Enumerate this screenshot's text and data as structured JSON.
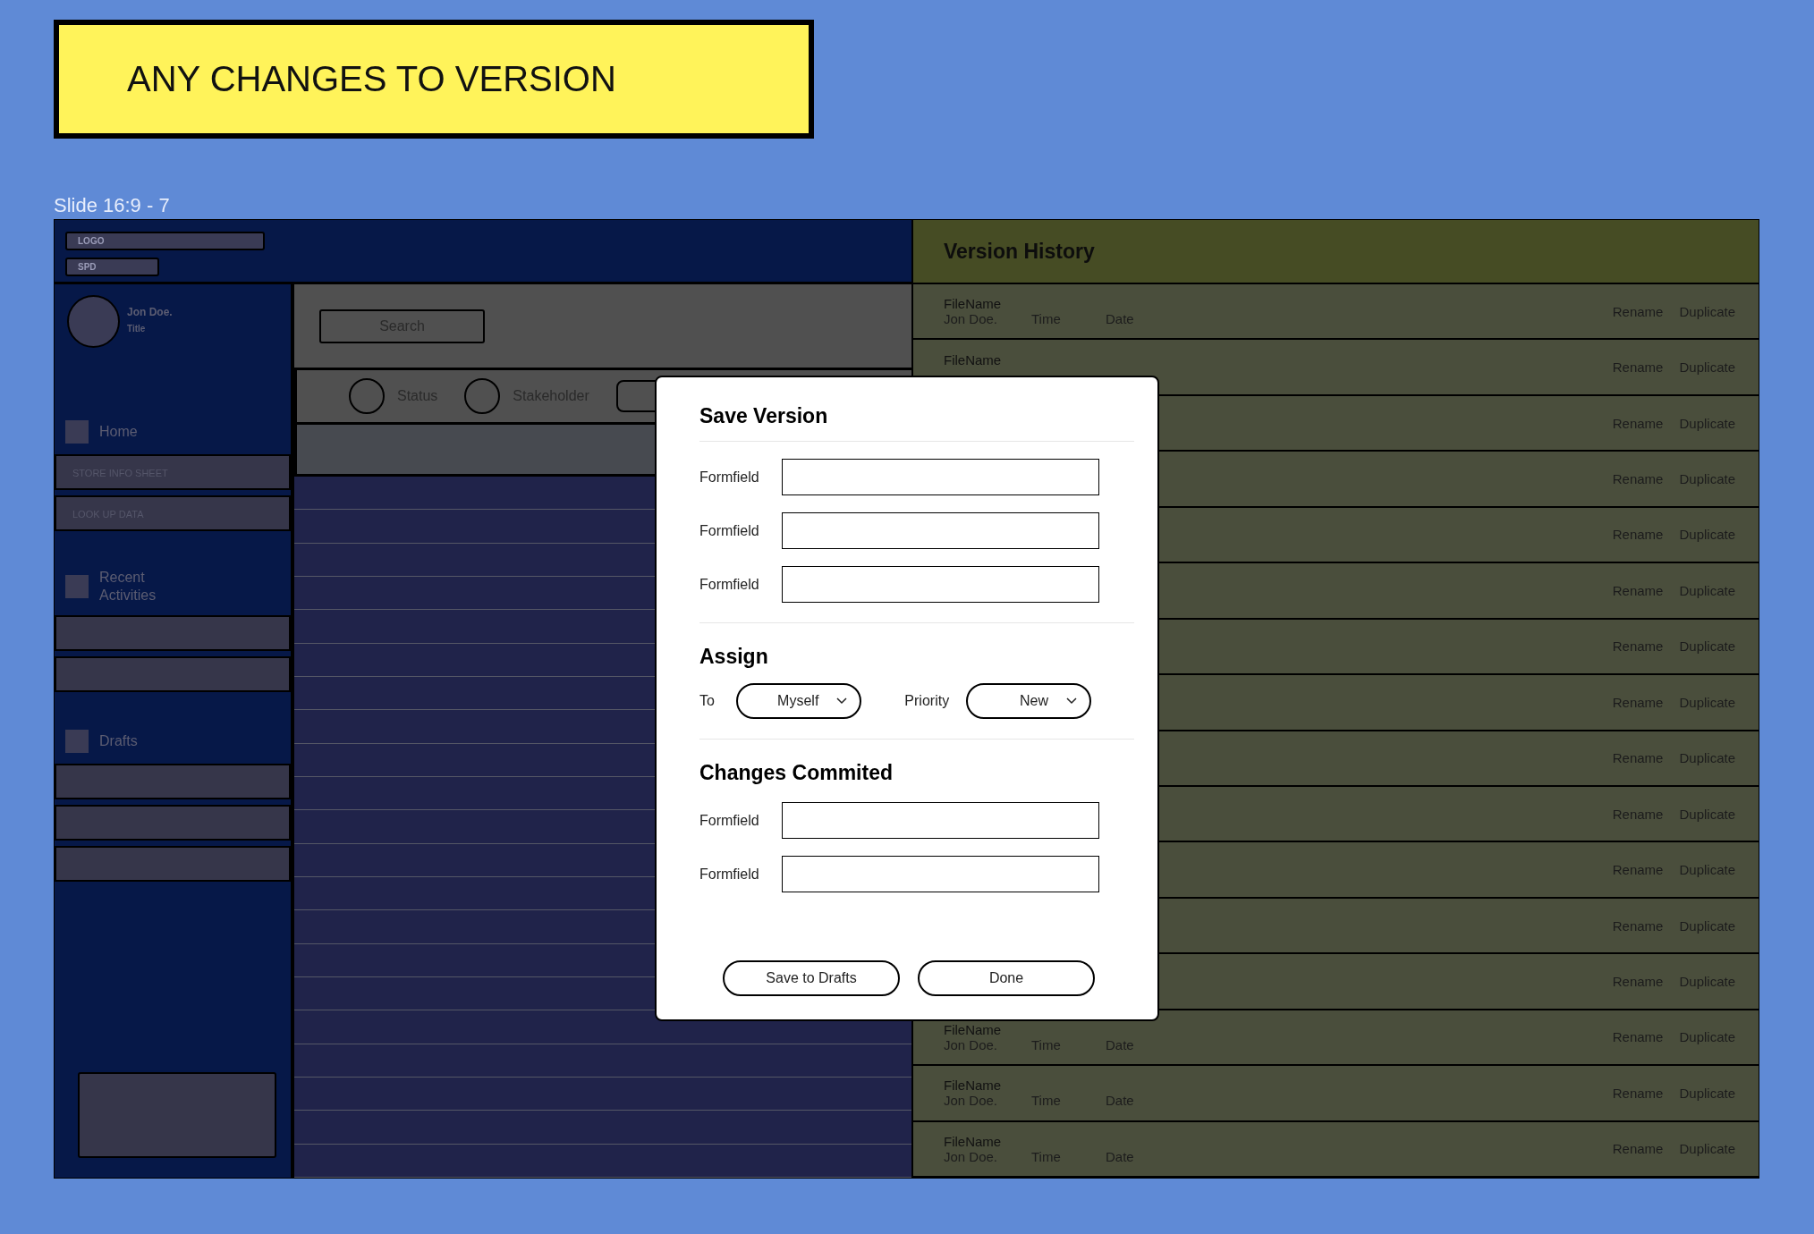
{
  "banner": {
    "text": "ANY CHANGES TO VERSION"
  },
  "frame_label": "Slide 16:9 - 7",
  "app": {
    "header": {
      "logo": "LOGO",
      "subtitle": "SPD"
    },
    "sidebar": {
      "user": {
        "name": "Jon Doe.",
        "title": "Title"
      },
      "sections": [
        {
          "label": "Home",
          "items": [
            {
              "kind": "link",
              "label": "STORE INFO SHEET"
            },
            {
              "kind": "link",
              "label": "LOOK UP DATA"
            }
          ]
        },
        {
          "label": "Recent Activities",
          "items": [
            {
              "kind": "blank"
            },
            {
              "kind": "blank"
            }
          ]
        },
        {
          "label": "Drafts",
          "items": [
            {
              "kind": "blank"
            },
            {
              "kind": "blank"
            },
            {
              "kind": "blank"
            }
          ]
        }
      ]
    },
    "search": {
      "label": "Search"
    },
    "filters": [
      {
        "kind": "radio",
        "label": "Status",
        "checked": false
      },
      {
        "kind": "radio",
        "label": "Stakeholder",
        "checked": false
      },
      {
        "kind": "pill"
      }
    ]
  },
  "version_history": {
    "title": "Version History",
    "rows": [
      {
        "file_name": "FileName",
        "author": "Jon Doe.",
        "time": "Time",
        "date": "Date",
        "actions": [
          "Rename",
          "Duplicate"
        ]
      },
      {
        "file_name": "FileName",
        "actions": [
          "Rename",
          "Duplicate"
        ]
      },
      {
        "actions": [
          "Rename",
          "Duplicate"
        ]
      },
      {
        "actions": [
          "Rename",
          "Duplicate"
        ]
      },
      {
        "actions": [
          "Rename",
          "Duplicate"
        ]
      },
      {
        "actions": [
          "Rename",
          "Duplicate"
        ]
      },
      {
        "actions": [
          "Rename",
          "Duplicate"
        ]
      },
      {
        "actions": [
          "Rename",
          "Duplicate"
        ]
      },
      {
        "actions": [
          "Rename",
          "Duplicate"
        ]
      },
      {
        "actions": [
          "Rename",
          "Duplicate"
        ]
      },
      {
        "actions": [
          "Rename",
          "Duplicate"
        ]
      },
      {
        "actions": [
          "Rename",
          "Duplicate"
        ]
      },
      {
        "actions": [
          "Rename",
          "Duplicate"
        ]
      },
      {
        "file_name": "FileName",
        "author": "Jon Doe.",
        "time": "Time",
        "date": "Date",
        "actions": [
          "Rename",
          "Duplicate"
        ]
      },
      {
        "file_name": "FileName",
        "author": "Jon Doe.",
        "time": "Time",
        "date": "Date",
        "actions": [
          "Rename",
          "Duplicate"
        ]
      },
      {
        "file_name": "FileName",
        "author": "Jon Doe.",
        "time": "Time",
        "date": "Date",
        "actions": [
          "Rename",
          "Duplicate"
        ]
      }
    ]
  },
  "modal": {
    "title": "Save Version",
    "fields": [
      {
        "label": "Formfield"
      },
      {
        "label": "Formfield"
      },
      {
        "label": "Formfield"
      }
    ],
    "assign": {
      "title": "Assign",
      "selects": [
        {
          "label": "To",
          "value": "Myself"
        },
        {
          "label": "Priority",
          "value": "New"
        }
      ]
    },
    "changes": {
      "title": "Changes Commited",
      "fields": [
        {
          "label": "Formfield"
        },
        {
          "label": "Formfield"
        }
      ]
    },
    "buttons": [
      "Save to Drafts",
      "Done"
    ]
  }
}
